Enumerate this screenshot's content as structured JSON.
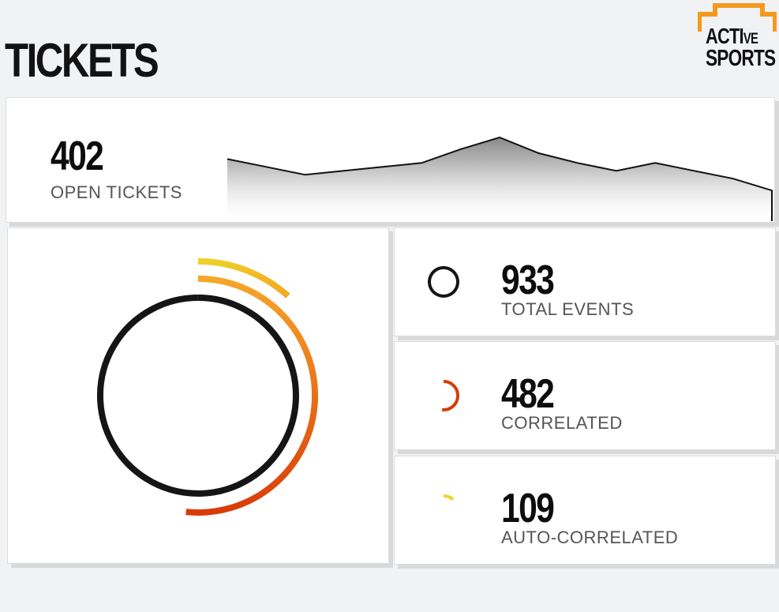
{
  "header": {
    "title": "TICKETS",
    "logo_text": {
      "part1": "AC",
      "part2": "TI",
      "part3": "VE",
      "line2": "SPORTS"
    }
  },
  "open_tickets": {
    "value": "402",
    "label": "OPEN TICKETS"
  },
  "stats": {
    "total": {
      "value": "933",
      "label": "TOTAL EVENTS"
    },
    "correlated": {
      "value": "482",
      "label": "CORRELATED"
    },
    "auto": {
      "value": "109",
      "label": "AUTO-CORRELATED"
    }
  },
  "chart_data": [
    {
      "type": "area",
      "x": [
        0,
        1,
        2,
        3,
        4,
        5,
        6,
        7,
        8,
        9,
        10,
        11,
        12,
        13,
        14
      ],
      "values": [
        60,
        52,
        44,
        48,
        52,
        56,
        70,
        82,
        66,
        56,
        48,
        56,
        48,
        40,
        28
      ]
    },
    {
      "type": "pie",
      "categories": [
        "TOTAL EVENTS",
        "CORRELATED",
        "AUTO-CORRELATED"
      ],
      "values": [
        933,
        482,
        109
      ]
    }
  ],
  "colors": {
    "total": "#151515",
    "correlated_start": "#f6a62a",
    "correlated_end": "#d83c08",
    "auto_start": "#ecd428",
    "auto_end": "#f5a624",
    "logo_orange": "#f39a1d"
  }
}
